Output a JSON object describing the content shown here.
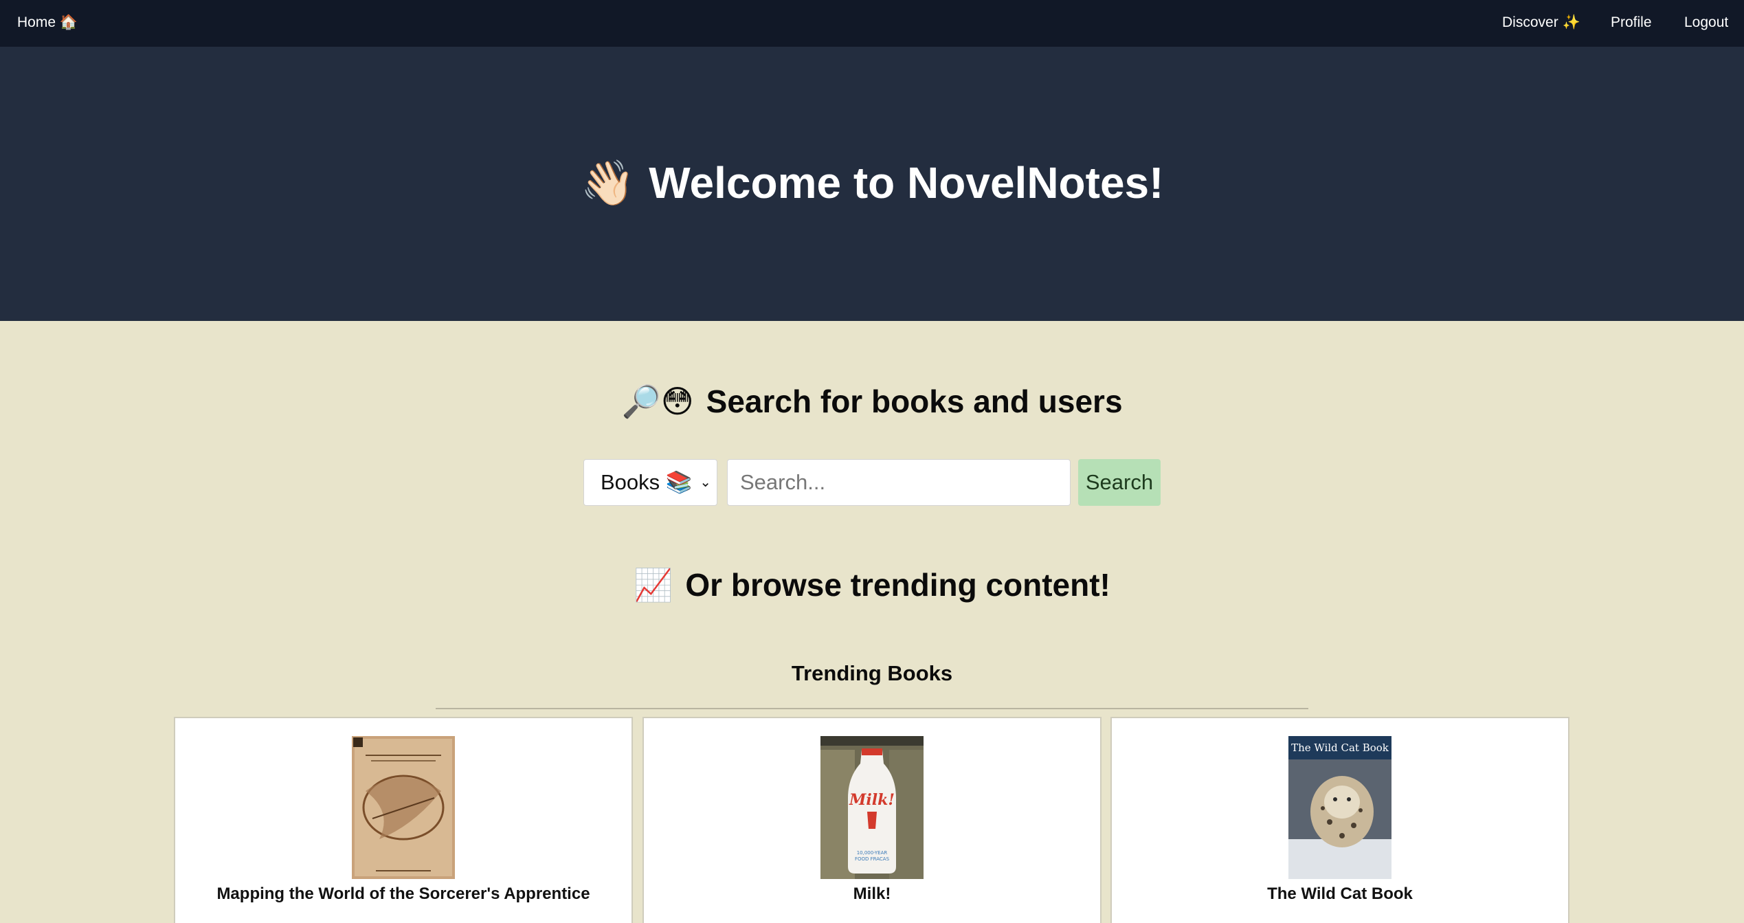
{
  "nav": {
    "home_label": "Home 🏠",
    "discover_label": "Discover ✨",
    "profile_label": "Profile",
    "logout_label": "Logout"
  },
  "hero": {
    "emoji": "👋🏻",
    "title": "Welcome to NovelNotes!"
  },
  "search": {
    "emoji": "🔎😳",
    "heading": "Search for books and users",
    "type_selected": "Books 📚",
    "placeholder": "Search...",
    "button_label": "Search"
  },
  "browse": {
    "emoji": "📈",
    "heading": "Or browse trending content!"
  },
  "trending": {
    "title": "Trending Books",
    "books": [
      {
        "title": "Mapping the World of the Sorcerer's Apprentice",
        "cover_text": "Mapping the World of the Sorcerer's Apprentice"
      },
      {
        "title": "Milk!",
        "cover_text": "Milk!"
      },
      {
        "title": "The Wild Cat Book",
        "cover_text": "The Wild Cat Book"
      }
    ]
  },
  "colors": {
    "nav_bg": "#111827",
    "hero_bg": "#232d3f",
    "page_bg": "#e8e4cb",
    "search_button_bg": "#b6e0b6"
  }
}
